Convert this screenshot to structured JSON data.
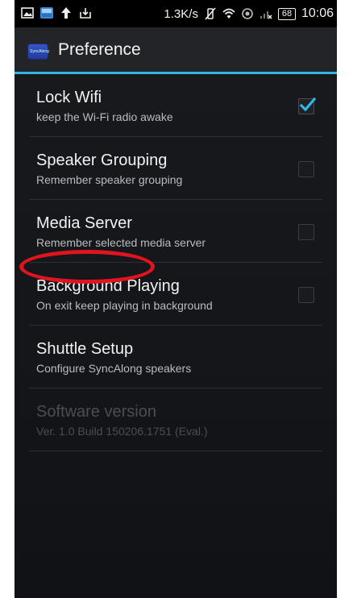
{
  "status_bar": {
    "speed": "1.3K/s",
    "battery": "68",
    "time": "10:06"
  },
  "action_bar": {
    "title": "Preference",
    "app_icon_name": "syncalong-app-icon",
    "app_icon_text": "SyncAlong"
  },
  "preferences": [
    {
      "title": "Lock Wifi",
      "summary": "keep the Wi-Fi radio awake",
      "checked": true,
      "enabled": true
    },
    {
      "title": "Speaker Grouping",
      "summary": "Remember speaker grouping",
      "checked": false,
      "enabled": true
    },
    {
      "title": "Media Server",
      "summary": "Remember selected media server",
      "checked": false,
      "enabled": true
    },
    {
      "title": "Background Playing",
      "summary": "On exit keep playing in background",
      "checked": false,
      "enabled": true
    },
    {
      "title": "Shuttle Setup",
      "summary": "Configure SyncAlong speakers",
      "enabled": true
    },
    {
      "title": "Software version",
      "summary": "Ver. 1.0 Build 150206.1751 (Eval.)",
      "enabled": false
    }
  ],
  "colors": {
    "accent": "#33b5e5",
    "highlight_ring": "#e0141e"
  }
}
